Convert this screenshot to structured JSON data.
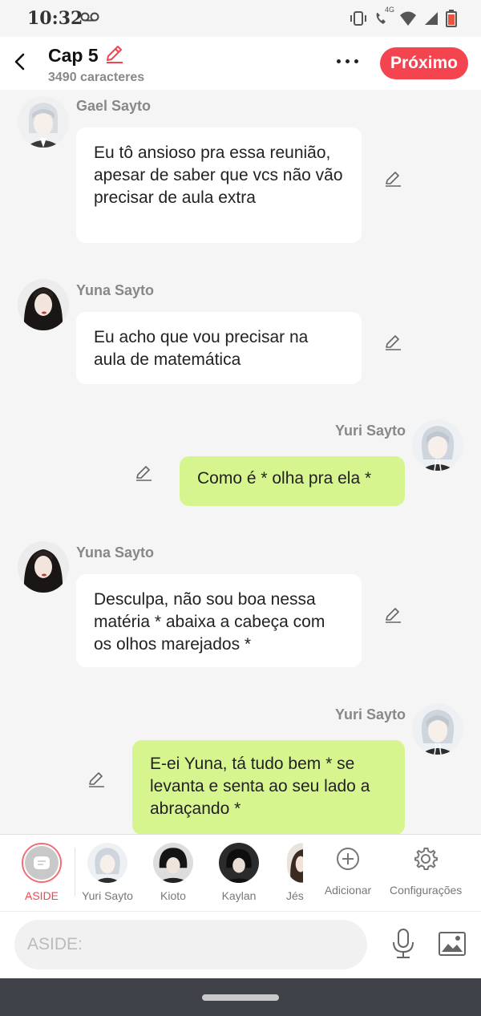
{
  "status": {
    "time": "10:32",
    "network": "4G"
  },
  "header": {
    "title": "Cap 5",
    "subtitle": "3490 caracteres",
    "next_label": "Próximo"
  },
  "messages": [
    {
      "sender": "Gael Sayto",
      "text": "Eu tô ansioso pra essa reunião, apesar de saber que vcs não vão precisar de aula extra",
      "side": "left"
    },
    {
      "sender": "Yuna Sayto",
      "text": "Eu acho que vou precisar na aula de matemática",
      "side": "left"
    },
    {
      "sender": "Yuri Sayto",
      "text": "Como é * olha pra ela *",
      "side": "right"
    },
    {
      "sender": "Yuna Sayto",
      "text": "Desculpa, não sou boa nessa matéria * abaixa a cabeça com os olhos marejados *",
      "side": "left"
    },
    {
      "sender": "Yuri Sayto",
      "text": "E-ei Yuna, tá tudo bem * se levanta e senta ao seu lado a abraçando *",
      "side": "right"
    }
  ],
  "characters": {
    "aside": "ASIDE",
    "items": [
      "Yuri Sayto",
      "Kioto",
      "Kaylan",
      "Jés"
    ],
    "add_label": "Adicionar",
    "settings_label": "Configurações"
  },
  "input": {
    "placeholder": "ASIDE:"
  },
  "colors": {
    "accent": "#f44450",
    "bubble_mine": "#d6f58e",
    "bubble_other": "#ffffff",
    "background": "#f5f5f5"
  }
}
